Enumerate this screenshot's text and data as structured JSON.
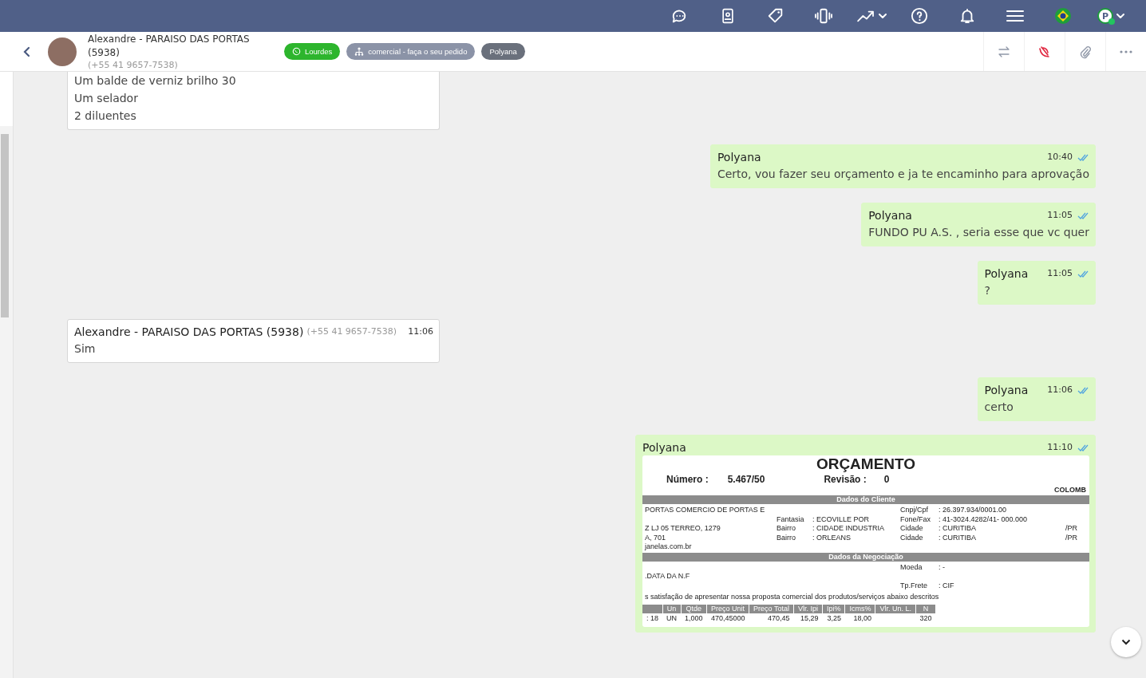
{
  "topbar": {
    "user_initial": "P",
    "online": true
  },
  "header": {
    "contact_name": "Alexandre - PARAISO DAS PORTAS (5938)",
    "phone": "(+55 41 9657-7538)",
    "tags": [
      {
        "label": "Lourdes",
        "kind": "whatsapp",
        "color": "#2db52d"
      },
      {
        "label": "comercial - faça o seu pedido",
        "kind": "department",
        "color": "#8b93a7"
      },
      {
        "label": "Polyana",
        "kind": "plain",
        "color": "#6a707c"
      }
    ]
  },
  "messages": [
    {
      "outgoing": false,
      "lines": [
        "Um balde de verniz brilho 30",
        "Um selador",
        "2 diluentes"
      ]
    },
    {
      "outgoing": true,
      "sender": "Polyana",
      "time": "10:40",
      "read": true,
      "lines": [
        "Certo, vou fazer seu orçamento e ja te encaminho para aprovação"
      ]
    },
    {
      "outgoing": true,
      "sender": "Polyana",
      "time": "11:05",
      "read": true,
      "lines": [
        "FUNDO PU A.S. , seria esse que vc quer"
      ]
    },
    {
      "outgoing": true,
      "sender": "Polyana",
      "time": "11:05",
      "read": true,
      "lines": [
        "?"
      ]
    },
    {
      "outgoing": false,
      "sender": "Alexandre - PARAISO DAS PORTAS (5938)",
      "phone": "(+55 41 9657-7538)",
      "time": "11:06",
      "lines": [
        "Sim"
      ]
    },
    {
      "outgoing": true,
      "sender": "Polyana",
      "time": "11:06",
      "read": true,
      "lines": [
        "certo"
      ]
    },
    {
      "outgoing": true,
      "sender": "Polyana",
      "time": "11:10",
      "read": true,
      "document": {
        "title": "ORÇAMENTO",
        "number_label": "Número :",
        "number": "5.467/50",
        "revision_label": "Revisão :",
        "revision": "0",
        "city": "COLOMB",
        "sections": [
          {
            "heading": "Dados do Cliente",
            "rows": [
              {
                "left": "PORTAS COMERCIO DE PORTAS E",
                "label2": "Cnpj/Cpf",
                "value2": ":   26.397.934/0001.00"
              },
              {
                "label": "Fantasia",
                "value": ":   ECOVILLE POR",
                "label2": "Fone/Fax",
                "value2": ":   41-3024.4282/41- 000.000"
              },
              {
                "left": "Z LJ 05 TERREO, 1279",
                "label": "Bairro",
                "value": ":   CIDADE INDUSTRIA",
                "label2": "Cidade",
                "value2": ":   CURITIBA",
                "uf": "/PR"
              },
              {
                "left": "A, 701",
                "label": "Bairro",
                "value": ":   ORLEANS",
                "label2": "Cidade",
                "value2": ":   CURITIBA",
                "uf": "/PR"
              },
              {
                "left": "janelas.com.br"
              }
            ]
          },
          {
            "heading": "Dados da Negociação",
            "rows": [
              {
                "label2": "Moeda",
                "value2": ":   -"
              },
              {
                "left": ".DATA DA N.F"
              },
              {
                "label2": "Tp.Frete",
                "value2": ":   CIF"
              }
            ]
          }
        ],
        "intro": "s satisfação de apresentar nossa proposta comercial dos produtos/serviços abaixo descritos",
        "table": {
          "columns": [
            "Un",
            "Qtde",
            "Preço Unit",
            "Preço Total",
            "Vlr. Ipi",
            "Ipi%",
            "Icms%",
            "Vlr. Un. L.",
            "N"
          ],
          "rows": [
            {
              "lead": ": 18",
              "cells": [
                "UN",
                "1,000",
                "470,45000",
                "470,45",
                "15,29",
                "3,25",
                "18,00",
                null,
                "320"
              ]
            }
          ]
        }
      }
    }
  ]
}
